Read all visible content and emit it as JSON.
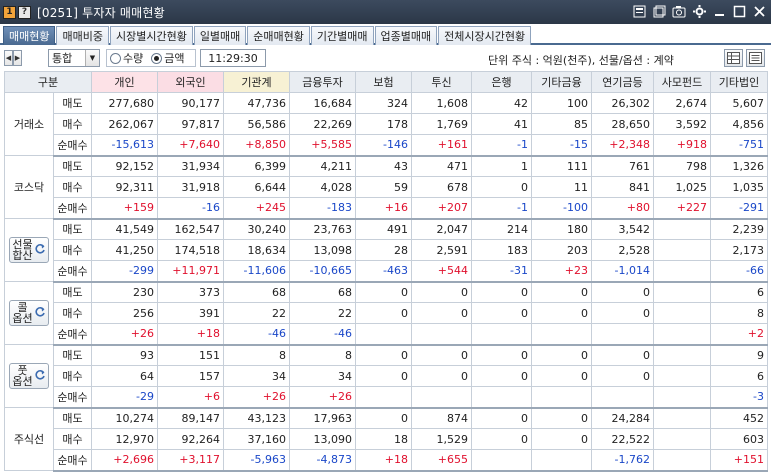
{
  "window": {
    "badge1": "1",
    "badge2": "?",
    "title": "[0251] 투자자 매매현황"
  },
  "tabs": [
    {
      "label": "매매현황",
      "active": true
    },
    {
      "label": "매매비중",
      "active": false
    },
    {
      "label": "시장별시간현황",
      "active": false
    },
    {
      "label": "일별매매",
      "active": false
    },
    {
      "label": "순매매현황",
      "active": false
    },
    {
      "label": "기간별매매",
      "active": false
    },
    {
      "label": "업종별매매",
      "active": false
    },
    {
      "label": "전체시장시간현황",
      "active": false
    }
  ],
  "toolbar": {
    "select_value": "통합",
    "radio_qty": "수량",
    "radio_amount": "금액",
    "selected_radio": "금액",
    "time": "11:29:30",
    "unit_text": "단위 주식 : 억원(천주), 선물/옵션 : 계약"
  },
  "table": {
    "header_group": "구분",
    "columns": [
      "개인",
      "외국인",
      "기관계",
      "금융투자",
      "보험",
      "투신",
      "은행",
      "기타금융",
      "연기금등",
      "사모펀드",
      "기타법인"
    ],
    "row_labels": [
      "매도",
      "매수",
      "순매수"
    ],
    "markets": [
      {
        "name": "거래소",
        "button": false,
        "rows": [
          [
            "277,680",
            "90,177",
            "47,736",
            "16,684",
            "324",
            "1,608",
            "42",
            "100",
            "26,302",
            "2,674",
            "5,607"
          ],
          [
            "262,067",
            "97,817",
            "56,586",
            "22,269",
            "178",
            "1,769",
            "41",
            "85",
            "28,650",
            "3,592",
            "4,856"
          ],
          [
            "-15,613",
            "+7,640",
            "+8,850",
            "+5,585",
            "-146",
            "+161",
            "-1",
            "-15",
            "+2,348",
            "+918",
            "-751"
          ]
        ]
      },
      {
        "name": "코스닥",
        "button": false,
        "rows": [
          [
            "92,152",
            "31,934",
            "6,399",
            "4,211",
            "43",
            "471",
            "1",
            "111",
            "761",
            "798",
            "1,326"
          ],
          [
            "92,311",
            "31,918",
            "6,644",
            "4,028",
            "59",
            "678",
            "0",
            "11",
            "841",
            "1,025",
            "1,035"
          ],
          [
            "+159",
            "-16",
            "+245",
            "-183",
            "+16",
            "+207",
            "-1",
            "-100",
            "+80",
            "+227",
            "-291"
          ]
        ]
      },
      {
        "name_lines": [
          "선물",
          "합산"
        ],
        "button": true,
        "rows": [
          [
            "41,549",
            "162,547",
            "30,240",
            "23,763",
            "491",
            "2,047",
            "214",
            "180",
            "3,542",
            "",
            "2,239"
          ],
          [
            "41,250",
            "174,518",
            "18,634",
            "13,098",
            "28",
            "2,591",
            "183",
            "203",
            "2,528",
            "",
            "2,173"
          ],
          [
            "-299",
            "+11,971",
            "-11,606",
            "-10,665",
            "-463",
            "+544",
            "-31",
            "+23",
            "-1,014",
            "",
            "-66"
          ]
        ]
      },
      {
        "name_lines": [
          "콜",
          "옵션"
        ],
        "button": true,
        "rows": [
          [
            "230",
            "373",
            "68",
            "68",
            "0",
            "0",
            "0",
            "0",
            "0",
            "",
            "6"
          ],
          [
            "256",
            "391",
            "22",
            "22",
            "0",
            "0",
            "0",
            "0",
            "0",
            "",
            "8"
          ],
          [
            "+26",
            "+18",
            "-46",
            "-46",
            "",
            "",
            "",
            "",
            "",
            "",
            "+2"
          ]
        ]
      },
      {
        "name_lines": [
          "풋",
          "옵션"
        ],
        "button": true,
        "rows": [
          [
            "93",
            "151",
            "8",
            "8",
            "0",
            "0",
            "0",
            "0",
            "0",
            "",
            "9"
          ],
          [
            "64",
            "157",
            "34",
            "34",
            "0",
            "0",
            "0",
            "0",
            "0",
            "",
            "6"
          ],
          [
            "-29",
            "+6",
            "+26",
            "+26",
            "",
            "",
            "",
            "",
            "",
            "",
            "-3"
          ]
        ]
      },
      {
        "name": "주식선",
        "button": false,
        "rows": [
          [
            "10,274",
            "89,147",
            "43,123",
            "17,963",
            "0",
            "874",
            "0",
            "0",
            "24,284",
            "",
            "452"
          ],
          [
            "12,970",
            "92,264",
            "37,160",
            "13,090",
            "18",
            "1,529",
            "0",
            "0",
            "22,522",
            "",
            "603"
          ],
          [
            "+2,696",
            "+3,117",
            "-5,963",
            "-4,873",
            "+18",
            "+655",
            "",
            "",
            "-1,762",
            "",
            "+151"
          ]
        ]
      }
    ]
  },
  "colors": {
    "positive": "#e0102d",
    "negative": "#1a47c8",
    "title_bar": "#2b3747",
    "active_tab": "#4a6a90"
  },
  "icons": [
    "badge-one-icon",
    "help-icon",
    "window-a-icon",
    "window-b-icon",
    "camera-icon",
    "gear-icon",
    "minimize-icon",
    "maximize-icon",
    "close-icon",
    "refresh-icon",
    "grid-view-icon",
    "list-view-icon"
  ]
}
